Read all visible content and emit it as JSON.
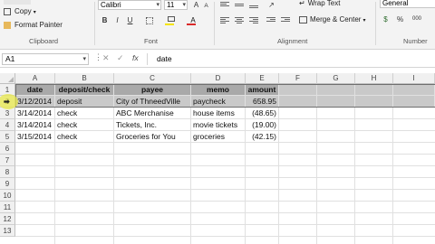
{
  "ribbon": {
    "clipboard": {
      "copy_label": "Copy",
      "format_painter_label": "Format Painter",
      "group_label": "Clipboard"
    },
    "font": {
      "font_name": "Calibri",
      "font_size": "11",
      "bold_label": "B",
      "italic_label": "I",
      "underline_label": "U",
      "grow_label": "A",
      "shrink_label": "A",
      "font_color_label": "A",
      "group_label": "Font"
    },
    "alignment": {
      "wrap_text_label": "Wrap Text",
      "merge_center_label": "Merge & Center",
      "group_label": "Alignment"
    },
    "number": {
      "format_value": "General",
      "currency_label": "$",
      "percent_label": "%",
      "group_label": "Number"
    }
  },
  "formula_bar": {
    "name_box": "A1",
    "fx_label": "fx",
    "content": "date"
  },
  "columns": [
    "A",
    "B",
    "C",
    "D",
    "E",
    "F",
    "G",
    "H",
    "I"
  ],
  "rows": [
    "1",
    "2",
    "3",
    "4",
    "5",
    "6",
    "7",
    "8",
    "9",
    "10",
    "11",
    "12",
    "13"
  ],
  "headers": [
    "date",
    "deposit/check",
    "payee",
    "memo",
    "amount"
  ],
  "records": [
    [
      "3/12/2014",
      "deposit",
      "City of ThneedVille",
      "paycheck",
      "658.95"
    ],
    [
      "3/14/2014",
      "check",
      "ABC Merchanise",
      "house items",
      "(48.65)"
    ],
    [
      "3/14/2014",
      "check",
      "Tickets, Inc.",
      "movie tickets",
      "(19.00)"
    ],
    [
      "3/15/2014",
      "check",
      "Groceries for You",
      "groceries",
      "(42.15)"
    ]
  ],
  "colors": {
    "header_fill": "#a9a9a9",
    "selection_fill": "#c9c9c9",
    "cursor_highlight": "#e8e84a",
    "font_color_bar": "#d92a2a",
    "highlight_bar": "#f5e400"
  }
}
